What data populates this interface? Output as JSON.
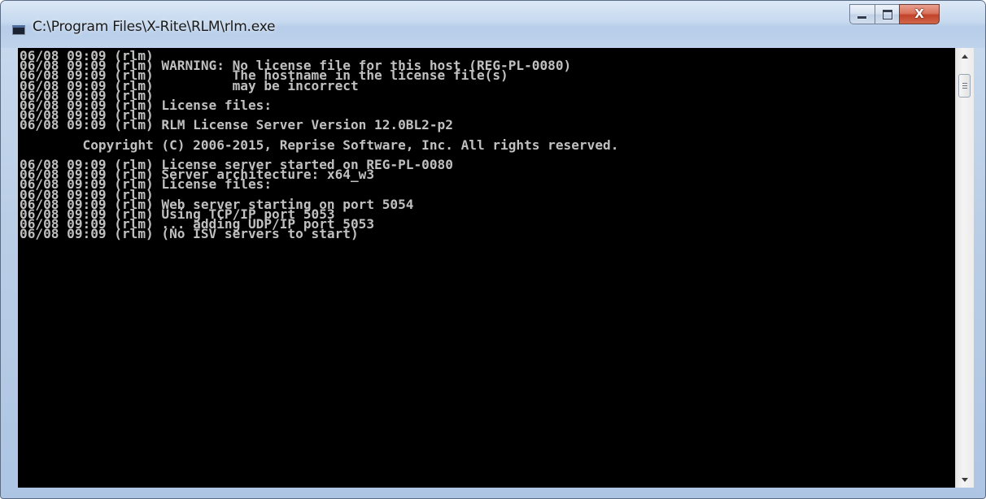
{
  "window": {
    "title": "C:\\Program Files\\X-Rite\\RLM\\rlm.exe",
    "icon": "console-window-icon",
    "controls": {
      "minimize": "minimize-icon",
      "maximize": "maximize-icon",
      "close_symbol": "X"
    }
  },
  "console": {
    "background": "#000000",
    "text_color": "#c0c0c0",
    "lines": [
      "06/08 09:09 (rlm)",
      "06/08 09:09 (rlm) WARNING: No license file for this host (REG-PL-0080)",
      "06/08 09:09 (rlm)          The hostname in the license file(s)",
      "06/08 09:09 (rlm)          may be incorrect",
      "06/08 09:09 (rlm)",
      "06/08 09:09 (rlm) License files:",
      "06/08 09:09 (rlm)",
      "06/08 09:09 (rlm) RLM License Server Version 12.0BL2-p2",
      "",
      "        Copyright (C) 2006-2015, Reprise Software, Inc. All rights reserved.",
      "",
      "06/08 09:09 (rlm) License server started on REG-PL-0080",
      "06/08 09:09 (rlm) Server architecture: x64_w3",
      "06/08 09:09 (rlm) License files:",
      "06/08 09:09 (rlm)",
      "06/08 09:09 (rlm) Web server starting on port 5054",
      "06/08 09:09 (rlm) Using TCP/IP port 5053",
      "06/08 09:09 (rlm) ... adding UDP/IP port 5053",
      "06/08 09:09 (rlm) (No ISV servers to start)"
    ]
  },
  "scrollbar": {
    "up_icon": "scroll-up-arrow-icon",
    "down_icon": "scroll-down-arrow-icon",
    "position": 0
  }
}
